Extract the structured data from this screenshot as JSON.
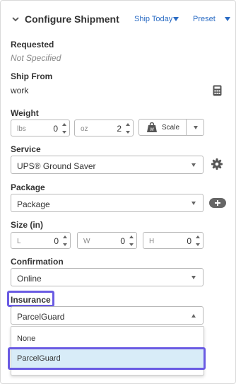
{
  "header": {
    "title": "Configure Shipment",
    "ship_today": "Ship Today",
    "preset": "Preset"
  },
  "requested": {
    "label": "Requested",
    "value": "Not Specified"
  },
  "ship_from": {
    "label": "Ship From",
    "value": "work"
  },
  "weight": {
    "label": "Weight",
    "lbs_placeholder": "lbs",
    "lbs_value": "0",
    "oz_placeholder": "oz",
    "oz_value": "2",
    "scale_label": "Scale"
  },
  "service": {
    "label": "Service",
    "value": "UPS® Ground Saver"
  },
  "package": {
    "label": "Package",
    "value": "Package"
  },
  "size": {
    "label": "Size (in)",
    "l_placeholder": "L",
    "l_value": "0",
    "w_placeholder": "W",
    "w_value": "0",
    "h_placeholder": "H",
    "h_value": "0"
  },
  "confirmation": {
    "label": "Confirmation",
    "value": "Online"
  },
  "insurance": {
    "label": "Insurance",
    "value": "ParcelGuard",
    "options": [
      "None",
      "ParcelGuard"
    ]
  },
  "colors": {
    "accent_link": "#2b6cc4",
    "highlight": "#6a5be3",
    "selected_option_bg": "#d8ecf8"
  },
  "icons": [
    "chevron-down-icon",
    "calculator-icon",
    "scale-icon",
    "gear-icon",
    "plus-icon"
  ]
}
